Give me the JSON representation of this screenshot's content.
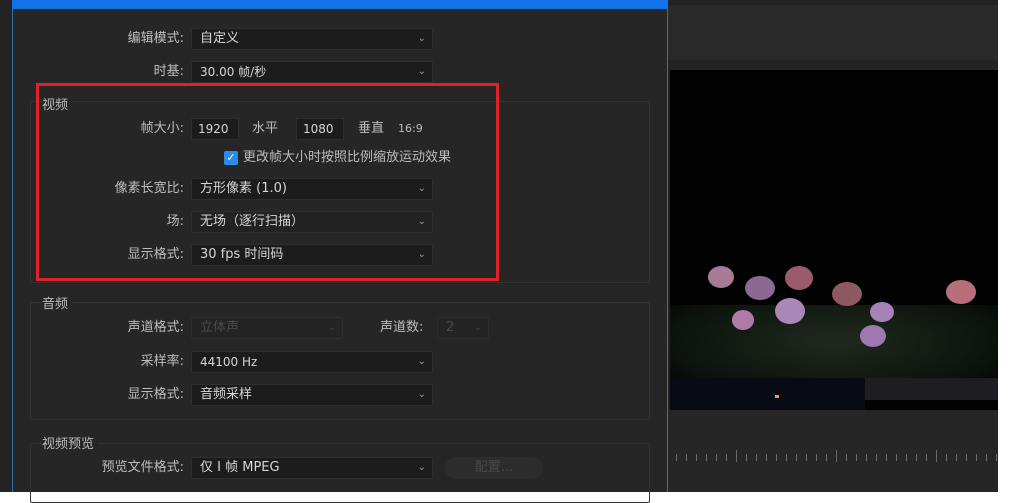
{
  "dialog": {
    "edit_mode": {
      "label": "编辑模式:",
      "value": "自定义"
    },
    "timebase": {
      "label": "时基:",
      "value": "30.00  帧/秒"
    },
    "video": {
      "title": "视频",
      "frame_size": {
        "label": "帧大小:",
        "width": "1920",
        "horizontal_label": "水平",
        "height": "1080",
        "vertical_label": "垂直",
        "aspect": "16:9"
      },
      "scale_checkbox": {
        "label": "更改帧大小时按照比例缩放运动效果",
        "checked": true
      },
      "pixel_aspect": {
        "label": "像素长宽比:",
        "value": "方形像素 (1.0)"
      },
      "fields": {
        "label": "场:",
        "value": "无场（逐行扫描）"
      },
      "display_format": {
        "label": "显示格式:",
        "value": "30 fps 时间码"
      }
    },
    "audio": {
      "title": "音频",
      "channel_format": {
        "label": "声道格式:",
        "value": "立体声"
      },
      "channel_count": {
        "label": "声道数:",
        "value": "2"
      },
      "sample_rate": {
        "label": "采样率:",
        "value": "44100 Hz"
      },
      "display_format": {
        "label": "显示格式:",
        "value": "音频采样"
      }
    },
    "video_preview": {
      "title": "视频预览",
      "preview_format": {
        "label": "预览文件格式:",
        "value": "仅 I 帧 MPEG"
      },
      "configure_label": "配置..."
    }
  },
  "colors": {
    "accent": "#1473e6",
    "highlight": "#e0212b"
  }
}
